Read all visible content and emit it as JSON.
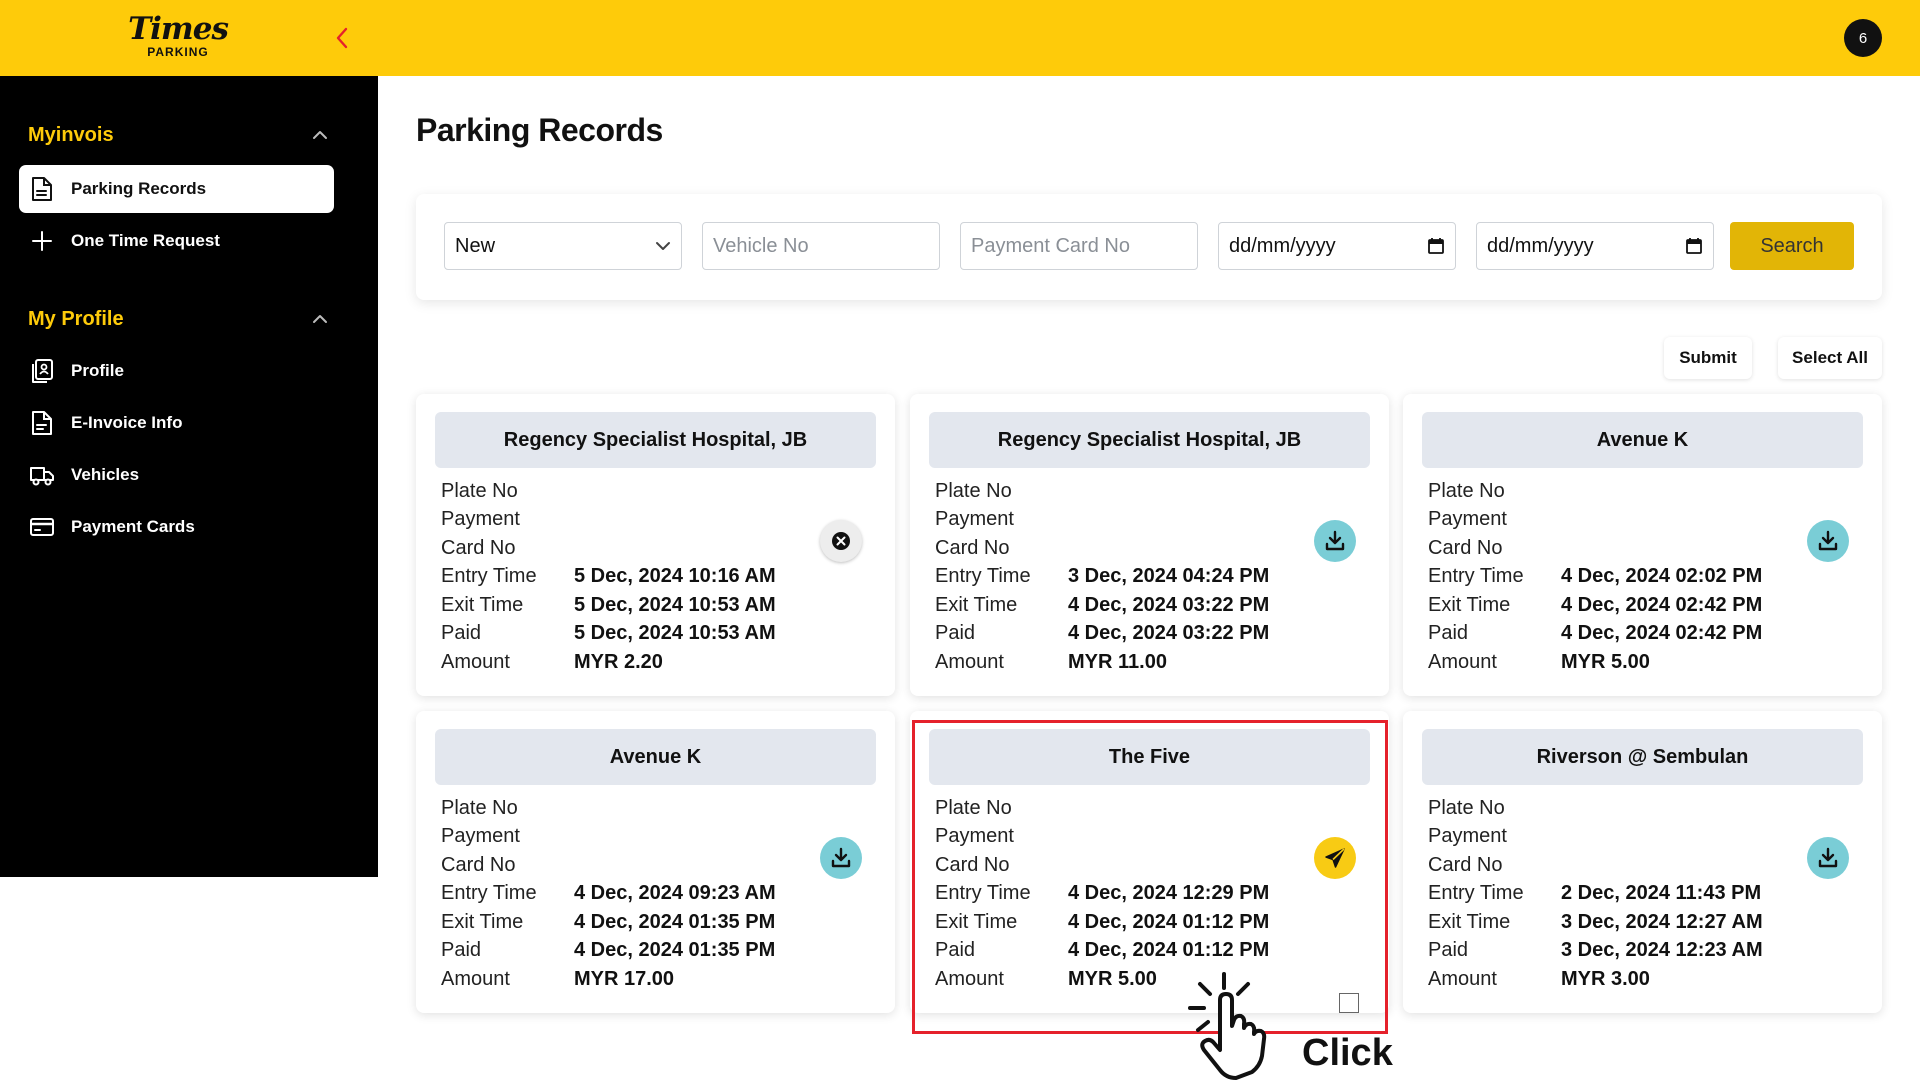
{
  "app": {
    "logo_main": "Times",
    "logo_sub": "PARKING",
    "notification_count": "6"
  },
  "sidebar": {
    "sections": [
      {
        "title": "Myinvois",
        "items": [
          {
            "label": "Parking Records",
            "icon": "document-icon",
            "active": true
          },
          {
            "label": "One Time Request",
            "icon": "plus-icon",
            "active": false
          }
        ]
      },
      {
        "title": "My Profile",
        "items": [
          {
            "label": "Profile",
            "icon": "profile-clipboard-icon",
            "active": false
          },
          {
            "label": "E-Invoice Info",
            "icon": "invoice-document-icon",
            "active": false
          },
          {
            "label": "Vehicles",
            "icon": "truck-icon",
            "active": false
          },
          {
            "label": "Payment Cards",
            "icon": "credit-card-icon",
            "active": false
          }
        ]
      }
    ]
  },
  "main": {
    "title": "Parking Records",
    "filters": {
      "status_value": "New",
      "vehicle_placeholder": "Vehicle No",
      "card_placeholder": "Payment Card No",
      "date_from_placeholder": "dd/mm/yyyy",
      "date_to_placeholder": "dd/mm/yyyy",
      "search_label": "Search"
    },
    "actions": {
      "submit_label": "Submit",
      "select_all_label": "Select All"
    },
    "field_labels": {
      "plate": "Plate No",
      "payment": "Payment",
      "card": "Card No",
      "entry": "Entry Time",
      "exit": "Exit Time",
      "paid": "Paid",
      "amount": "Amount"
    },
    "records": [
      {
        "location": "Regency Specialist Hospital, JB",
        "entry": "5 Dec, 2024 10:16 AM",
        "exit": "5 Dec, 2024 10:53 AM",
        "paid": "5 Dec, 2024 10:53 AM",
        "amount": "MYR 2.20",
        "action": "cancel-icon"
      },
      {
        "location": "Regency Specialist Hospital, JB",
        "entry": "3 Dec, 2024 04:24 PM",
        "exit": "4 Dec, 2024 03:22 PM",
        "paid": "4 Dec, 2024 03:22 PM",
        "amount": "MYR 11.00",
        "action": "download-icon"
      },
      {
        "location": "Avenue K",
        "entry": "4 Dec, 2024 02:02 PM",
        "exit": "4 Dec, 2024 02:42 PM",
        "paid": "4 Dec, 2024 02:42 PM",
        "amount": "MYR 5.00",
        "action": "download-icon"
      },
      {
        "location": "Avenue K",
        "entry": "4 Dec, 2024 09:23 AM",
        "exit": "4 Dec, 2024 01:35 PM",
        "paid": "4 Dec, 2024 01:35 PM",
        "amount": "MYR 17.00",
        "action": "download-icon"
      },
      {
        "location": "The Five",
        "entry": "4 Dec, 2024 12:29 PM",
        "exit": "4 Dec, 2024 01:12 PM",
        "paid": "4 Dec, 2024 01:12 PM",
        "amount": "MYR 5.00",
        "action": "send-icon",
        "has_checkbox": true,
        "highlighted": true
      },
      {
        "location": "Riverson @ Sembulan",
        "entry": "2 Dec, 2024 11:43 PM",
        "exit": "3 Dec, 2024 12:27 AM",
        "paid": "3 Dec, 2024 12:23 AM",
        "amount": "MYR 3.00",
        "action": "download-icon"
      }
    ]
  },
  "annotation": {
    "click_label": "Click"
  },
  "colors": {
    "brand_yellow": "#FECB0A",
    "search_button": "#E2B506",
    "download_teal": "#7ACDD6",
    "highlight_red": "#E5212B",
    "sidebar_bg": "#000000"
  }
}
